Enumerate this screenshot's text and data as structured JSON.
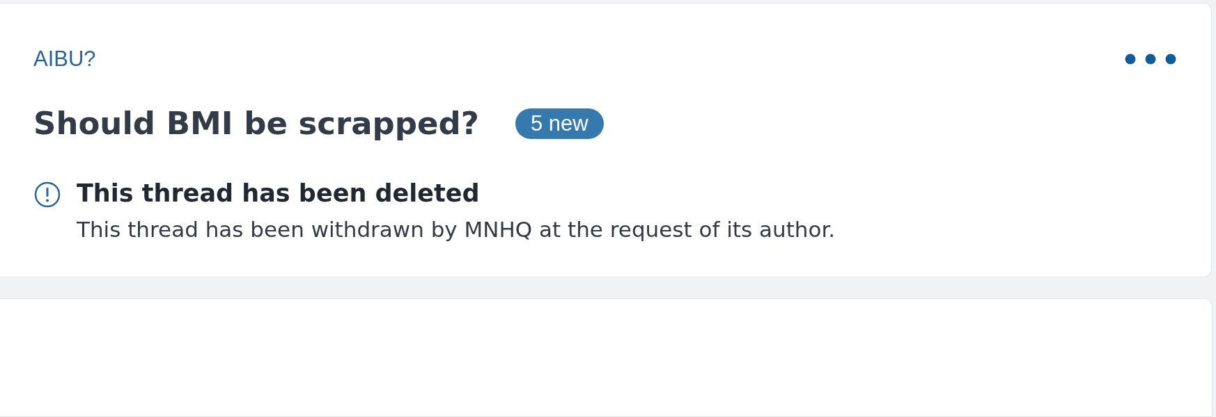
{
  "thread": {
    "category": "AIBU?",
    "title": "Should BMI be scrapped?",
    "badge": "5 new",
    "notice": {
      "heading": "This thread has been deleted",
      "message": "This thread has been withdrawn by MNHQ at the request of its author."
    }
  }
}
